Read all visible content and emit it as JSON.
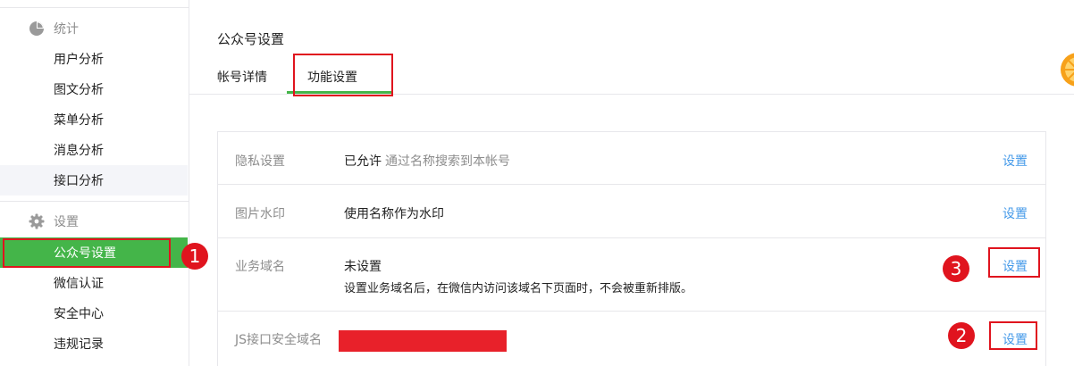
{
  "sidebar": {
    "stats_group": {
      "title": "统计",
      "icon": "pie-chart-icon"
    },
    "stats_items": [
      {
        "label": "用户分析"
      },
      {
        "label": "图文分析"
      },
      {
        "label": "菜单分析"
      },
      {
        "label": "消息分析"
      },
      {
        "label": "接口分析"
      }
    ],
    "settings_group": {
      "title": "设置",
      "icon": "gear-icon"
    },
    "settings_items": [
      {
        "label": "公众号设置"
      },
      {
        "label": "微信认证"
      },
      {
        "label": "安全中心"
      },
      {
        "label": "违规记录"
      }
    ]
  },
  "main": {
    "title": "公众号设置",
    "tabs": [
      {
        "label": "帐号详情"
      },
      {
        "label": "功能设置"
      }
    ],
    "rows": [
      {
        "label": "隐私设置",
        "value": "已允许",
        "hint": "通过名称搜索到本帐号",
        "link": "设置"
      },
      {
        "label": "图片水印",
        "value": "使用名称作为水印",
        "link": "设置"
      },
      {
        "label": "业务域名",
        "value": "未设置",
        "description": "设置业务域名后，在微信内访问该域名下页面时，不会被重新排版。",
        "link": "设置"
      },
      {
        "label": "JS接口安全域名",
        "link": "设置"
      }
    ]
  },
  "annotations": {
    "badge_1": "1",
    "badge_2": "2",
    "badge_3": "3"
  },
  "colors": {
    "accent_green": "#44b549",
    "link_blue": "#459ae9",
    "annotation_red": "#e0141e"
  }
}
